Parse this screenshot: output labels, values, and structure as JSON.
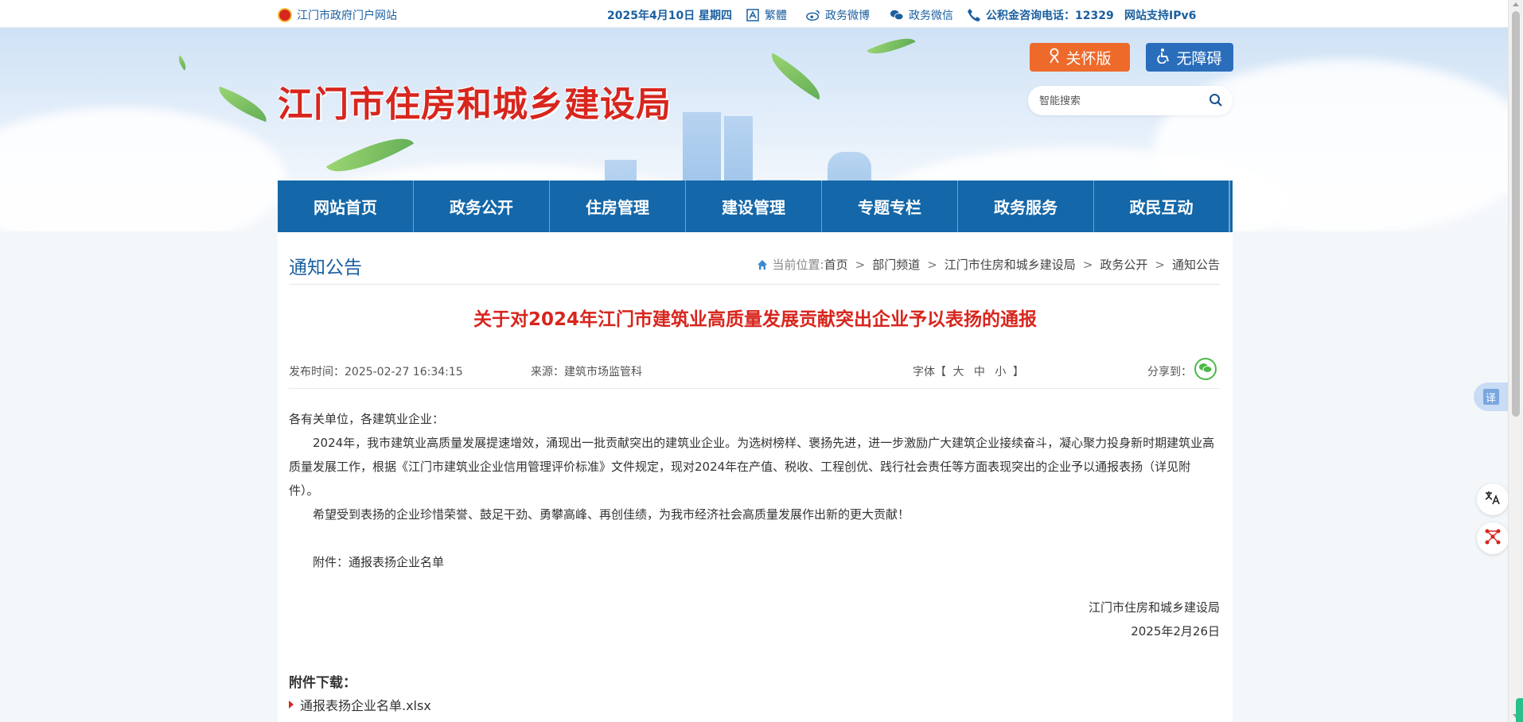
{
  "topbar": {
    "portal": "江门市政府门户网站",
    "date": "2025年4月10日 星期四",
    "traditional": "繁體",
    "weibo": "政务微博",
    "wechat": "政务微信",
    "hotline": "公积金咨询电话：12329",
    "ipv6": "网站支持IPv6"
  },
  "header": {
    "site_title": "江门市住房和城乡建设局",
    "care_label": "关怀版",
    "accessibility_label": "无障碍",
    "search_placeholder": "智能搜索"
  },
  "nav": {
    "items": [
      "网站首页",
      "政务公开",
      "住房管理",
      "建设管理",
      "专题专栏",
      "政务服务",
      "政民互动"
    ]
  },
  "breadcrumb": {
    "section_title": "通知公告",
    "current_label": "当前位置:",
    "items": [
      "首页",
      "部门频道",
      "江门市住房和城乡建设局",
      "政务公开",
      "通知公告"
    ],
    "separator": ">"
  },
  "article": {
    "title": "关于对2024年江门市建筑业高质量发展贡献突出企业予以表扬的通报",
    "publish_time": "发布时间：2025-02-27 16:34:15",
    "source": "来源：建筑市场监管科",
    "font_label": "字体【",
    "font_large": "大",
    "font_medium": "中",
    "font_small": "小",
    "font_close": "】",
    "share_label": "分享到：",
    "salutation": "各有关单位，各建筑业企业：",
    "para1": "2024年，我市建筑业高质量发展提速增效，涌现出一批贡献突出的建筑业企业。为选树榜样、褒扬先进，进一步激励广大建筑企业接续奋斗，凝心聚力投身新时期建筑业高质量发展工作，根据《江门市建筑业企业信用管理评价标准》文件规定，现对2024年在产值、税收、工程创优、践行社会责任等方面表现突出的企业予以通报表扬（详见附件）。",
    "para2": "希望受到表扬的企业珍惜荣誉、鼓足干劲、勇攀高峰、再创佳绩，为我市经济社会高质量发展作出新的更大贡献！",
    "attachment_note": "附件：通报表扬企业名单",
    "signature": "江门市住房和城乡建设局",
    "sign_date": "2025年2月26日",
    "download_heading": "附件下载：",
    "download_file": "通报表扬企业名单.xlsx"
  },
  "floats": {
    "translate": "译"
  }
}
